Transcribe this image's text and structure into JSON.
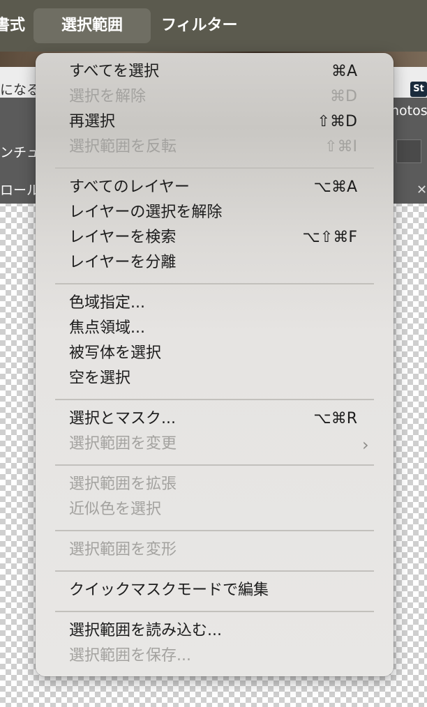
{
  "menubar": {
    "format": "書式",
    "select": "選択範囲",
    "filter": "フィルター"
  },
  "background": {
    "text1": "になる",
    "text2": "notos",
    "text3": "ンチュ",
    "text4": "ロール",
    "badge": "St"
  },
  "menu": {
    "items": [
      {
        "label": "すべてを選択",
        "shortcut": "⌘A",
        "enabled": true
      },
      {
        "label": "選択を解除",
        "shortcut": "⌘D",
        "enabled": false
      },
      {
        "label": "再選択",
        "shortcut": "⇧⌘D",
        "enabled": true
      },
      {
        "label": "選択範囲を反転",
        "shortcut": "⇧⌘I",
        "enabled": false
      },
      {
        "label": "すべてのレイヤー",
        "shortcut": "⌥⌘A",
        "enabled": true
      },
      {
        "label": "レイヤーの選択を解除",
        "shortcut": "",
        "enabled": true
      },
      {
        "label": "レイヤーを検索",
        "shortcut": "⌥⇧⌘F",
        "enabled": true
      },
      {
        "label": "レイヤーを分離",
        "shortcut": "",
        "enabled": true
      },
      {
        "label": "色域指定...",
        "shortcut": "",
        "enabled": true
      },
      {
        "label": "焦点領域...",
        "shortcut": "",
        "enabled": true
      },
      {
        "label": "被写体を選択",
        "shortcut": "",
        "enabled": true
      },
      {
        "label": "空を選択",
        "shortcut": "",
        "enabled": true
      },
      {
        "label": "選択とマスク...",
        "shortcut": "⌥⌘R",
        "enabled": true
      },
      {
        "label": "選択範囲を変更",
        "shortcut": "",
        "enabled": false
      },
      {
        "label": "選択範囲を拡張",
        "shortcut": "",
        "enabled": false
      },
      {
        "label": "近似色を選択",
        "shortcut": "",
        "enabled": false
      },
      {
        "label": "選択範囲を変形",
        "shortcut": "",
        "enabled": false
      },
      {
        "label": "クイックマスクモードで編集",
        "shortcut": "",
        "enabled": true
      },
      {
        "label": "選択範囲を読み込む...",
        "shortcut": "",
        "enabled": true
      },
      {
        "label": "選択範囲を保存...",
        "shortcut": "",
        "enabled": false
      }
    ],
    "submenu_icon": "chevron-right-icon"
  }
}
